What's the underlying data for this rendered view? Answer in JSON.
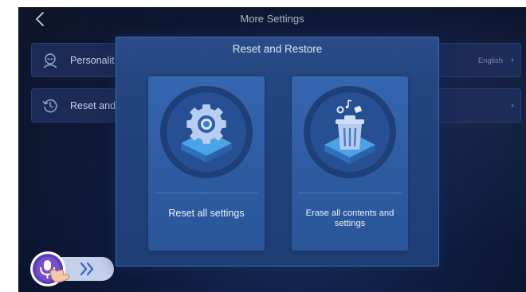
{
  "header": {
    "title": "More Settings",
    "back_icon": "chevron-left-icon"
  },
  "settings_rows": [
    {
      "label": "Personalit",
      "value": "English",
      "icon": "person-icon"
    },
    {
      "label": "Reset and",
      "value": "",
      "icon": "clock-restore-icon"
    }
  ],
  "modal": {
    "title": "Reset and Restore",
    "options": [
      {
        "label": "Reset all settings",
        "icon": "gear-reset-icon"
      },
      {
        "label": "Erase all contents and settings",
        "icon": "trash-erase-icon"
      }
    ]
  },
  "voice_assistant": {
    "icon": "microphone-icon",
    "expand_icon": "double-chevron-right-icon"
  },
  "colors": {
    "background": "#0d1a3a",
    "modal": "#24457f",
    "card": "#2d5ba2",
    "accent": "#8fb4ff"
  }
}
